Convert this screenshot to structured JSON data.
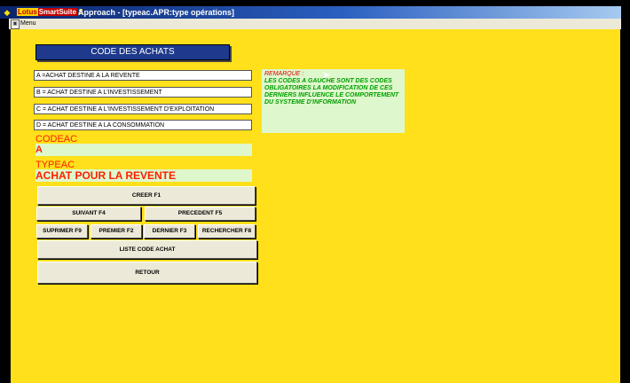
{
  "window": {
    "title": "Approach - [typeac.APR:type opérations]",
    "brand": {
      "part1": "Lotus",
      "part2": "SmartSuite"
    }
  },
  "menubar": {
    "menu_label": "Menu"
  },
  "form": {
    "header": "CODE DES ACHATS",
    "codes": [
      "A =ACHAT DESTINE A LA REVENTE",
      "B = ACHAT DESTINE A L'INVESTISSEMENT",
      "C = ACHAT DESTINE A L'INVESTISSEMENT D'EXPLOITATION",
      "D = ACHAT DESTINE A LA CONSOMMATION"
    ],
    "codeac_label": "CODEAC",
    "codeac_value": "A",
    "typeac_label": "TYPEAC",
    "typeac_value": "ACHAT POUR LA REVENTE",
    "remark_title": "REMARQUE :",
    "remark_body": "LES CODES A GAUCHE SONT DES CODES OBLIGATOIRES LA MODIFICATION DE CES DERNIERS INFLUENCE LE COMPORTEMENT DU SYSTEME D'INFORMATION"
  },
  "buttons": {
    "creer": "CREER F1",
    "suivant": "SUIVANT F4",
    "precedent": "PRECEDENT F5",
    "supprimer": "SUPRIMER F9",
    "premier": "PREMIER F2",
    "dernier": "DERNIER F3",
    "rechercher": "RECHERCHER F8",
    "liste": "LISTE CODE ACHAT",
    "retour": "RETOUR"
  }
}
